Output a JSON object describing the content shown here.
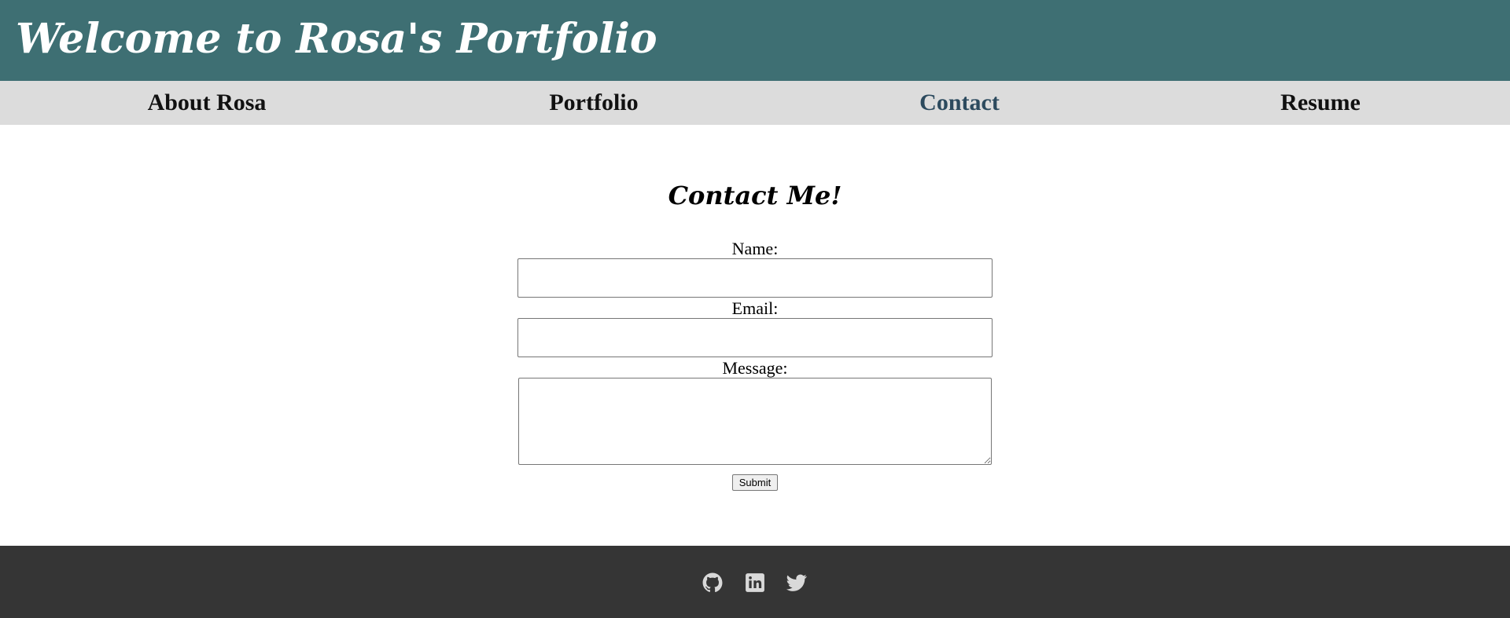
{
  "header": {
    "title": "Welcome to Rosa's Portfolio"
  },
  "nav": {
    "items": [
      {
        "label": "About Rosa",
        "active": false
      },
      {
        "label": "Portfolio",
        "active": false
      },
      {
        "label": "Contact",
        "active": true
      },
      {
        "label": "Resume",
        "active": false
      }
    ]
  },
  "contact": {
    "title": "Contact Me!",
    "name_label": "Name:",
    "name_value": "",
    "email_label": "Email:",
    "email_value": "",
    "message_label": "Message:",
    "message_value": "",
    "submit_label": "Submit"
  },
  "footer": {
    "icons": [
      "github-icon",
      "linkedin-icon",
      "twitter-icon"
    ]
  },
  "colors": {
    "header_bg": "#3e6f73",
    "nav_bg": "#dcdcdc",
    "nav_active": "#2c4a5e",
    "footer_bg": "#353535",
    "footer_icon": "#d9d9d9"
  }
}
